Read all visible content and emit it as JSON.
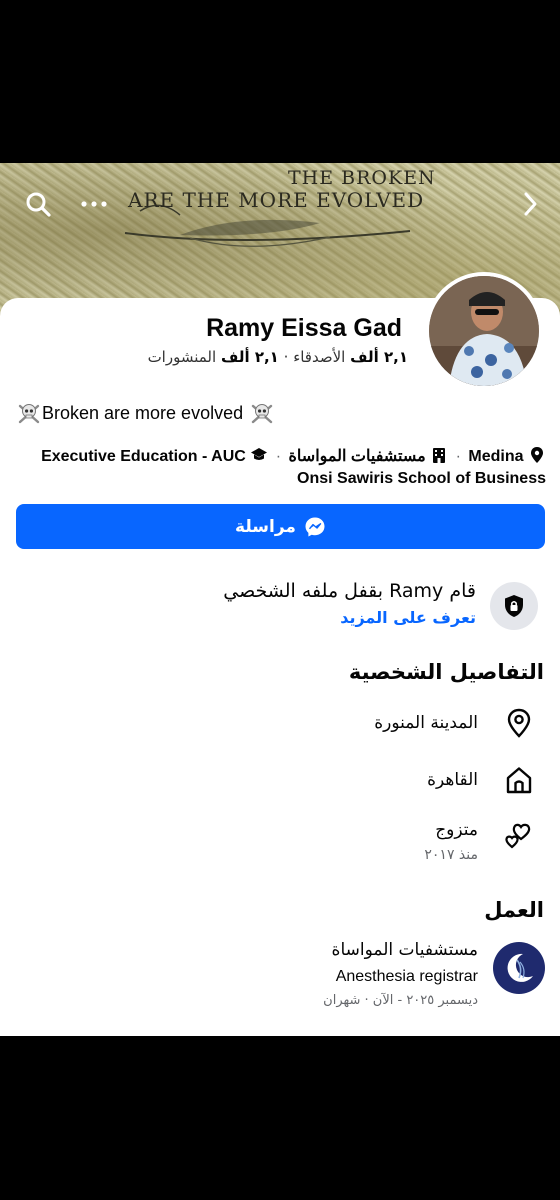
{
  "cover": {
    "text_line1": "THE BROKEN",
    "text_line2": "ARE THE MORE EVOLVED"
  },
  "header_icons": {
    "search": "search-icon",
    "more": "more-icon",
    "forward": "chevron-right-icon"
  },
  "profile": {
    "name": "Ramy Eissa Gad",
    "friends_count": "٢,١ ألف",
    "friends_label": "الأصدقاء",
    "separator": "·",
    "posts_count": "٢,١ ألف",
    "posts_label": "المنشورات",
    "bio": "Broken are more evolved"
  },
  "details_line": {
    "location": "Medina",
    "workplace": "مستشفيات المواساة",
    "education": "Executive Education - AUC",
    "education_line2": "Onsi Sawiris School of Business",
    "dot": "·"
  },
  "message_button": {
    "label": "مراسلة"
  },
  "locked_profile": {
    "title": "قام Ramy بقفل ملفه الشخصي",
    "link": "تعرف على المزيد"
  },
  "personal_details": {
    "title": "التفاصيل الشخصية",
    "items": [
      {
        "icon": "location-pin-icon",
        "text": "المدينة المنورة"
      },
      {
        "icon": "home-icon",
        "text": "القاهرة"
      },
      {
        "icon": "hearts-icon",
        "text": "متزوج",
        "sub": "منذ ٢٠١٧"
      }
    ]
  },
  "work": {
    "title": "العمل",
    "employer": "مستشفيات المواساة",
    "role": "Anesthesia registrar",
    "dates": "ديسمبر ٢٠٢٥ - الآن · شهران"
  },
  "colors": {
    "accent": "#0866ff",
    "secondary_text": "#65676b",
    "lock_circle": "#e4e6eb"
  }
}
